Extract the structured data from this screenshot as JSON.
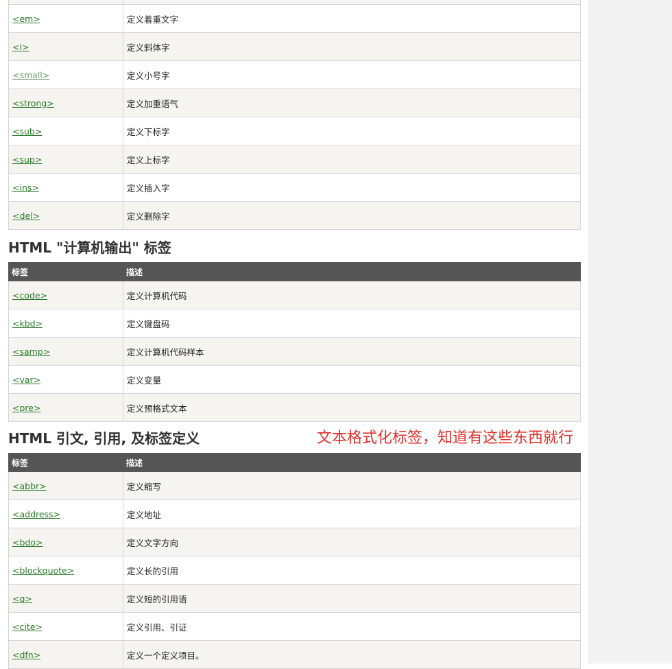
{
  "table1": {
    "rows": [
      {
        "tag": "<em>",
        "desc": "定义着重文字"
      },
      {
        "tag": "<i>",
        "desc": "定义斜体字"
      },
      {
        "tag": "<small>",
        "desc": "定义小号字"
      },
      {
        "tag": "<strong>",
        "desc": "定义加重语气"
      },
      {
        "tag": "<sub>",
        "desc": "定义下标字"
      },
      {
        "tag": "<sup>",
        "desc": "定义上标字"
      },
      {
        "tag": "<ins>",
        "desc": "定义插入字"
      },
      {
        "tag": "<del>",
        "desc": "定义删除字"
      }
    ]
  },
  "section2": {
    "title": "HTML \"计算机输出\" 标签",
    "header": {
      "tag": "标签",
      "desc": "描述"
    },
    "rows": [
      {
        "tag": "<code>",
        "desc": "定义计算机代码"
      },
      {
        "tag": "<kbd>",
        "desc": "定义键盘码"
      },
      {
        "tag": "<samp>",
        "desc": "定义计算机代码样本"
      },
      {
        "tag": "<var>",
        "desc": "定义变量"
      },
      {
        "tag": "<pre>",
        "desc": "定义预格式文本"
      }
    ]
  },
  "section3": {
    "title": "HTML 引文, 引用, 及标签定义",
    "header": {
      "tag": "标签",
      "desc": "描述"
    },
    "rows": [
      {
        "tag": "<abbr>",
        "desc": "定义缩写"
      },
      {
        "tag": "<address>",
        "desc": "定义地址"
      },
      {
        "tag": "<bdo>",
        "desc": "定义文字方向"
      },
      {
        "tag": "<blockquote>",
        "desc": "定义长的引用"
      },
      {
        "tag": "<q>",
        "desc": "定义短的引用语"
      },
      {
        "tag": "<cite>",
        "desc": "定义引用、引证"
      },
      {
        "tag": "<dfn>",
        "desc": "定义一个定义项目。"
      }
    ]
  },
  "annotation": "文本格式化标签，知道有这些东西就行",
  "colors": {
    "link": "#2b7a2b",
    "header_bg": "#555555",
    "annotation": "#e0302a"
  }
}
